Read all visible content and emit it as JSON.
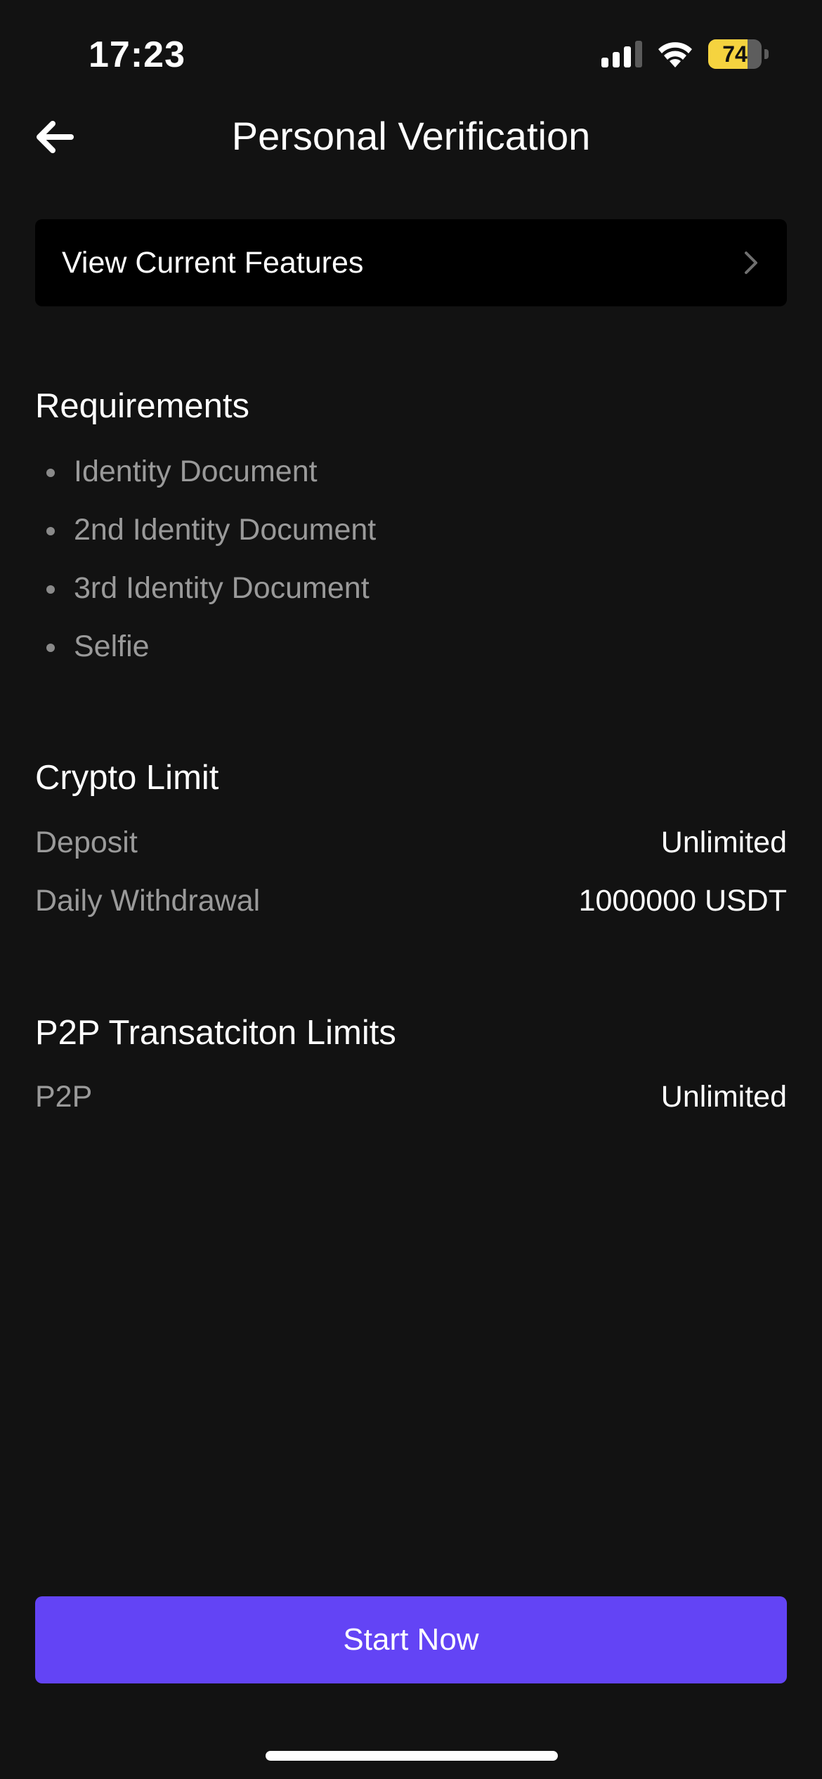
{
  "status_bar": {
    "time": "17:23",
    "battery_level": "74",
    "battery_fraction": 0.74,
    "icons": [
      "cellular-signal-icon",
      "wifi-icon",
      "battery-icon"
    ]
  },
  "header": {
    "back_icon": "arrow-left-icon",
    "title": "Personal Verification"
  },
  "features_card": {
    "label": "View Current Features",
    "icon": "chevron-right-icon"
  },
  "requirements": {
    "title": "Requirements",
    "items": [
      {
        "label": "Identity Document"
      },
      {
        "label": "2nd Identity Document"
      },
      {
        "label": "3rd Identity Document"
      },
      {
        "label": "Selfie"
      }
    ]
  },
  "crypto_limit": {
    "title": "Crypto Limit",
    "rows": [
      {
        "label": "Deposit",
        "value": "Unlimited"
      },
      {
        "label": "Daily Withdrawal",
        "value": "1000000 USDT"
      }
    ]
  },
  "p2p_limits": {
    "title": "P2P Transatciton Limits",
    "rows": [
      {
        "label": "P2P",
        "value": "Unlimited"
      }
    ]
  },
  "footer": {
    "start_button_label": "Start Now"
  },
  "colors": {
    "background": "#121212",
    "card": "#000000",
    "accent": "#6344f5",
    "secondary_text": "#9a9a9a",
    "battery": "#f5d33f"
  }
}
